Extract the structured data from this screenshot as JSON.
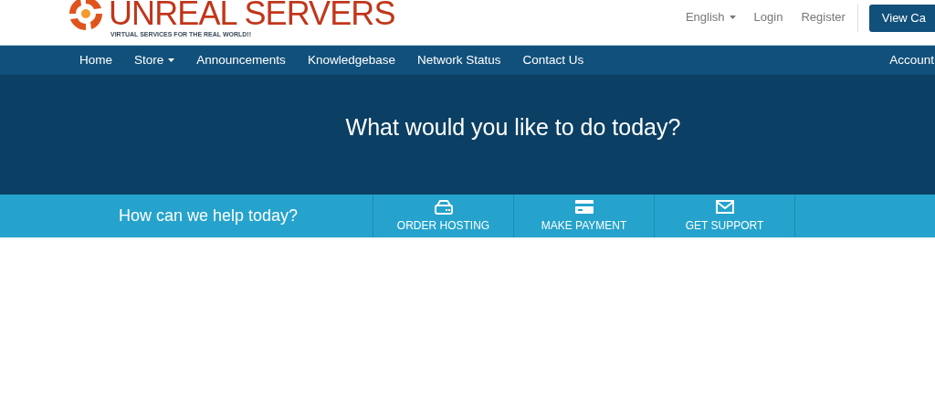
{
  "header": {
    "logo": {
      "name": "UNREAL SERVERS",
      "tagline": "VIRTUAL SERVICES FOR THE REAL WORLD!!"
    },
    "links": [
      {
        "label": "English",
        "dropdown": true
      },
      {
        "label": "Login",
        "dropdown": false
      },
      {
        "label": "Register",
        "dropdown": false
      }
    ],
    "cart_button": "View Ca"
  },
  "nav": {
    "items": [
      {
        "label": "Home",
        "dropdown": false
      },
      {
        "label": "Store",
        "dropdown": true
      },
      {
        "label": "Announcements",
        "dropdown": false
      },
      {
        "label": "Knowledgebase",
        "dropdown": false
      },
      {
        "label": "Network Status",
        "dropdown": false
      },
      {
        "label": "Contact Us",
        "dropdown": false
      }
    ],
    "account": "Account"
  },
  "hero": {
    "heading": "What would you like to do today?"
  },
  "help_bar": {
    "title": "How can we help today?",
    "actions": [
      {
        "kind": "server",
        "label": "ORDER HOSTING"
      },
      {
        "kind": "card",
        "label": "MAKE PAYMENT"
      },
      {
        "kind": "envelope",
        "label": "GET SUPPORT"
      }
    ]
  }
}
